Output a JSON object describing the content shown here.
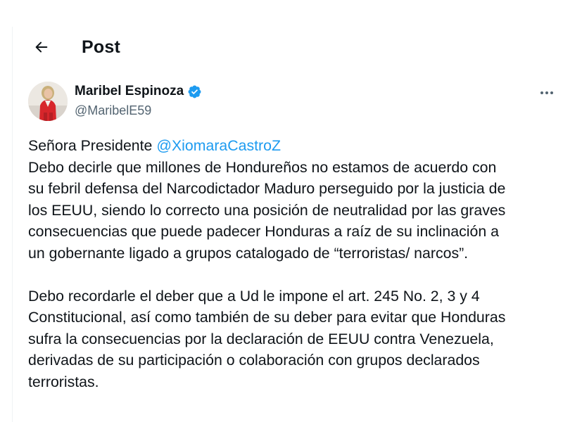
{
  "header": {
    "back_icon": "arrow-left-icon",
    "title": "Post"
  },
  "author": {
    "display_name": "Maribel Espinoza",
    "handle": "@MaribelE59",
    "verified": true,
    "verified_color": "#1d9bf0",
    "avatar": "profile-photo",
    "more_icon": "more-horizontal-icon"
  },
  "post": {
    "intro": "Señora Presidente ",
    "mention": "@XiomaraCastroZ",
    "paragraph1_lines": [
      "Debo decirle que millones de Hondureños no estamos de acuerdo con",
      "su febril defensa del Narcodictador Maduro perseguido por la justicia de",
      "los EEUU, siendo lo correcto una posición de neutralidad por las graves",
      "consecuencias que puede padecer Honduras a raíz de su inclinación a",
      "un gobernante ligado a grupos catalogado de “terroristas/ narcos”."
    ],
    "paragraph2_lines": [
      "Debo recordarle el deber que a Ud le impone el art. 245 No. 2, 3 y 4",
      "Constitucional, así como también de su deber para evitar que Honduras",
      "sufra la consecuencias por la declaración de EEUU contra Venezuela,",
      "derivadas de su participación o colaboración con grupos declarados",
      "terroristas."
    ]
  },
  "colors": {
    "text": "#0f1419",
    "secondary_text": "#536471",
    "link": "#1d9bf0"
  }
}
